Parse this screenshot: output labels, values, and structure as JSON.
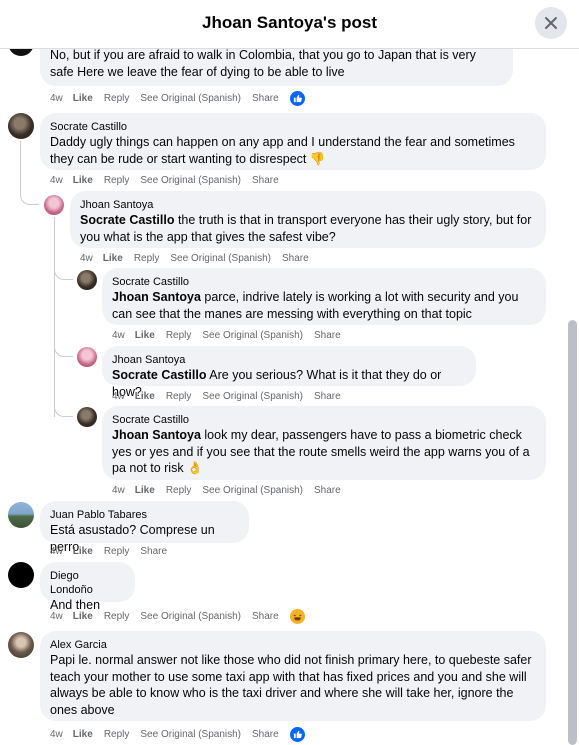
{
  "header": {
    "title": "Jhoan Santoya's post"
  },
  "comments": [
    {
      "text": "No, but if you are afraid to walk in Colombia, that you go to Japan that is very safe Here we leave the fear of dying to be able to live",
      "actions": {
        "time": "4w",
        "like": "Like",
        "reply": "Reply",
        "see_original": "See Original (Spanish)",
        "share": "Share"
      },
      "reaction": "like-reaction-icon"
    },
    {
      "author": "Socrate Castillo",
      "text": "Daddy ugly things can happen on any app and I understand the fear and sometimes they can be rude or start wanting to disrespect 👎",
      "actions": {
        "time": "4w",
        "like": "Like",
        "reply": "Reply",
        "see_original": "See Original (Spanish)",
        "share": "Share"
      }
    },
    {
      "author": "Jhoan Santoya",
      "mention": "Socrate Castillo",
      "text": " the truth is that in transport everyone has their ugly story, but for you what is the app that gives the safest vibe?",
      "actions": {
        "time": "4w",
        "like": "Like",
        "reply": "Reply",
        "see_original": "See Original (Spanish)",
        "share": "Share"
      }
    },
    {
      "author": "Socrate Castillo",
      "mention": "Jhoan Santoya",
      "text": " parce, indrive lately is working a lot with security and you can see that the manes are messing with everything on that topic",
      "actions": {
        "time": "4w",
        "like": "Like",
        "reply": "Reply",
        "see_original": "See Original (Spanish)",
        "share": "Share"
      }
    },
    {
      "author": "Jhoan Santoya",
      "mention": "Socrate Castillo",
      "text": " Are you serious? What is it that they do or how?",
      "actions": {
        "time": "4w",
        "like": "Like",
        "reply": "Reply",
        "see_original": "See Original (Spanish)",
        "share": "Share"
      }
    },
    {
      "author": "Socrate Castillo",
      "mention": "Jhoan Santoya",
      "text": " look my dear, passengers have to pass a biometric check yes or yes and if you see that the route smells weird the app warns you of a pa not to risk 👌",
      "actions": {
        "time": "4w",
        "like": "Like",
        "reply": "Reply",
        "see_original": "See Original (Spanish)",
        "share": "Share"
      }
    },
    {
      "author": "Juan Pablo Tabares",
      "text": "Está asustado? Comprese un perro",
      "actions": {
        "time": "4w",
        "like": "Like",
        "reply": "Reply",
        "share": "Share"
      }
    },
    {
      "author": "Diego Londoño",
      "text": "And then",
      "actions": {
        "time": "4w",
        "like": "Like",
        "reply": "Reply",
        "see_original": "See Original (Spanish)",
        "share": "Share"
      },
      "reaction": "haha-reaction-icon"
    },
    {
      "author": "Alex Garcia",
      "text": "Papi le. normal answer not like those who did not finish primary here, to quebeste safer teach your mother to use some taxi app with that has fixed prices and you and she will always be able to know who is the taxi driver and where she will take her, ignore the ones above",
      "actions": {
        "time": "4w",
        "like": "Like",
        "reply": "Reply",
        "see_original": "See Original (Spanish)",
        "share": "Share"
      },
      "reaction": "like-reaction-icon"
    }
  ],
  "colors": {
    "bubble": "#f0f2f5",
    "meta": "#65676b",
    "text": "#050505",
    "like_blue": "#0866ff",
    "haha_yellow": "#f7b125"
  }
}
